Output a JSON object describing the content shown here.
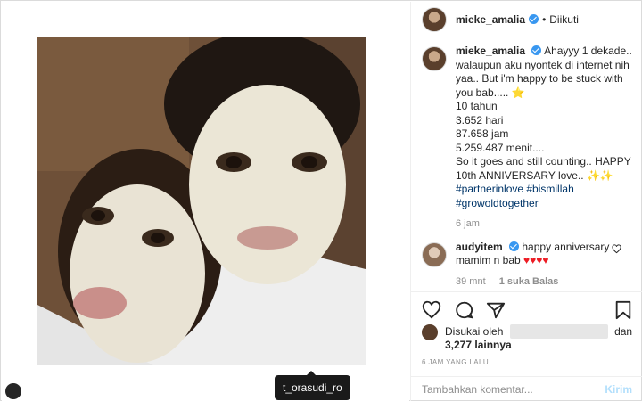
{
  "post": {
    "username": "mieke_amalia",
    "follow_status": "Diikuti",
    "caption_lines": [
      "Ahayyy 1 dekade..",
      "walaupun aku nyontek di internet nih",
      "yaa.. But i'm happy to be stuck with",
      "you bab..... ⭐",
      "10 tahun",
      "3.652 hari",
      "87.658 jam",
      "5.259.487 menit....",
      "So it goes and still counting.. HAPPY",
      "10th ANNIVERSARY love.. ✨✨"
    ],
    "hashtags": [
      "#partnerinlove #bismillah",
      "#growoldtogether"
    ],
    "caption_time": "6 jam",
    "tagged_user": "t_orasudi_ro"
  },
  "comment": {
    "username": "audyitem",
    "text_line1": "happy anniversary",
    "text_line2": "mamim n bab",
    "hearts": "♥♥♥♥",
    "time": "39 mnt",
    "likes": "1 suka",
    "reply": "Balas"
  },
  "likes_bar": {
    "prefix": "Disukai oleh",
    "conj": "dan",
    "others": "3,277 lainnya"
  },
  "timestamp": "6 JAM YANG LALU",
  "add_comment": {
    "placeholder": "Tambahkan komentar...",
    "send": "Kirim"
  },
  "icons": [
    "heart-icon",
    "comment-icon",
    "share-icon",
    "bookmark-icon",
    "verified-icon",
    "user-tag-icon"
  ]
}
